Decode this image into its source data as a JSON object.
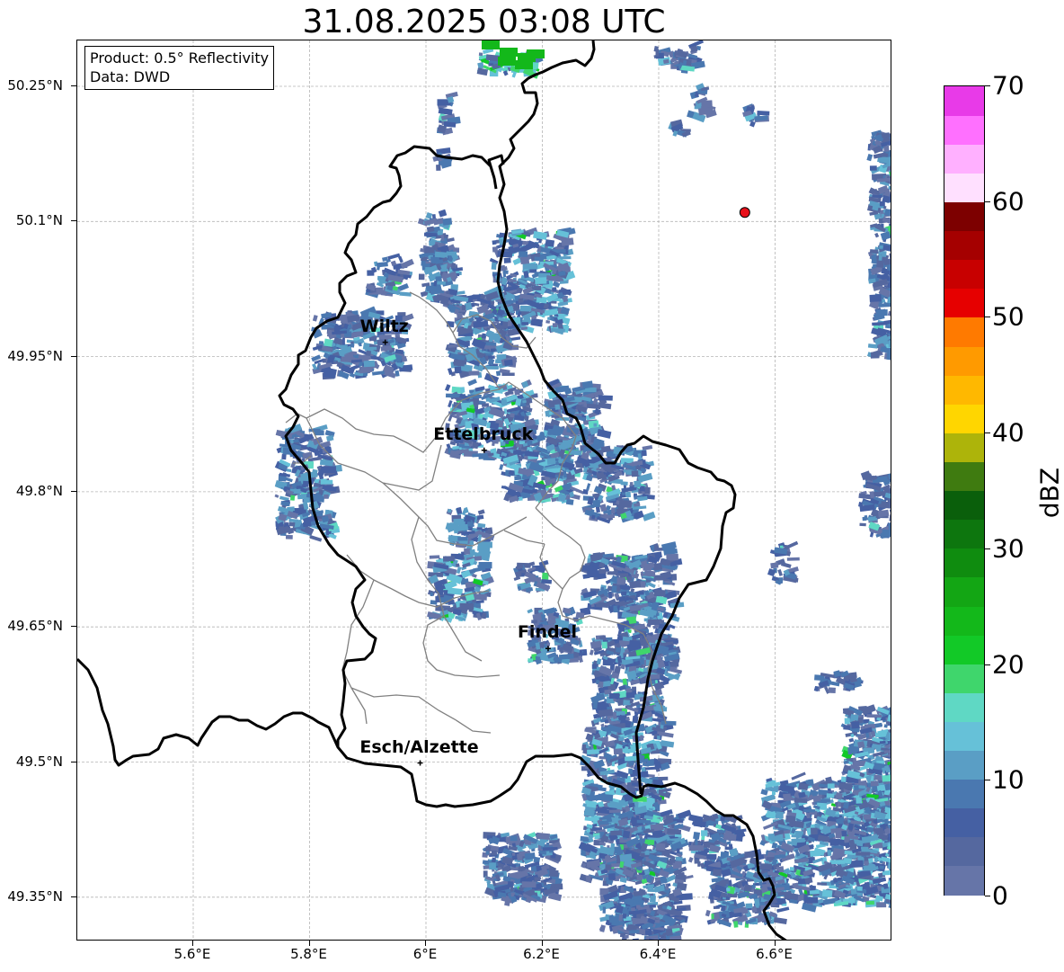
{
  "title": "31.08.2025 03:08 UTC",
  "info_box": {
    "product": "Product: 0.5° Reflectivity",
    "data_source": "Data: DWD"
  },
  "axes": {
    "lon_range": [
      5.4,
      6.8
    ],
    "lat_range": [
      49.3,
      50.3
    ],
    "y_ticks": [
      "50.25°N",
      "50.1°N",
      "49.95°N",
      "49.8°N",
      "49.65°N",
      "49.5°N",
      "49.35°N"
    ],
    "y_values": [
      50.25,
      50.1,
      49.95,
      49.8,
      49.65,
      49.5,
      49.35
    ],
    "x_ticks": [
      "5.6°E",
      "5.8°E",
      "6°E",
      "6.2°E",
      "6.4°E",
      "6.6°E"
    ],
    "x_values": [
      5.6,
      5.8,
      6.0,
      6.2,
      6.4,
      6.6
    ],
    "grid": true
  },
  "cities": [
    {
      "name": "Wiltz",
      "lon": 5.93,
      "lat": 49.966
    },
    {
      "name": "Ettelbruck",
      "lon": 6.1,
      "lat": 49.846
    },
    {
      "name": "Findel",
      "lon": 6.21,
      "lat": 49.626
    },
    {
      "name": "Esch/Alzette",
      "lon": 5.99,
      "lat": 49.499
    }
  ],
  "radar_site": {
    "lon": 6.548,
    "lat": 50.11,
    "color": "#e8101a"
  },
  "colorbar": {
    "label": "dBZ",
    "min": 0,
    "max": 70,
    "tick_labels": [
      "0",
      "10",
      "20",
      "30",
      "40",
      "50",
      "60",
      "70"
    ],
    "tick_values": [
      0,
      10,
      20,
      30,
      40,
      50,
      60,
      70
    ],
    "colors": [
      "#6675a8",
      "#55689f",
      "#4560a3",
      "#4a78b0",
      "#5a9ec5",
      "#66c1d8",
      "#5fd8c4",
      "#3fd66c",
      "#12c927",
      "#13b81a",
      "#13a614",
      "#0f8c0f",
      "#0d760e",
      "#0a5f0b",
      "#3f7b10",
      "#adb40a",
      "#ffd600",
      "#ffb800",
      "#ff9a00",
      "#ff7a00",
      "#e60000",
      "#c80000",
      "#a50000",
      "#7d0000",
      "#ffe0ff",
      "#ffb0ff",
      "#ff70ff",
      "#e83ae8"
    ]
  }
}
